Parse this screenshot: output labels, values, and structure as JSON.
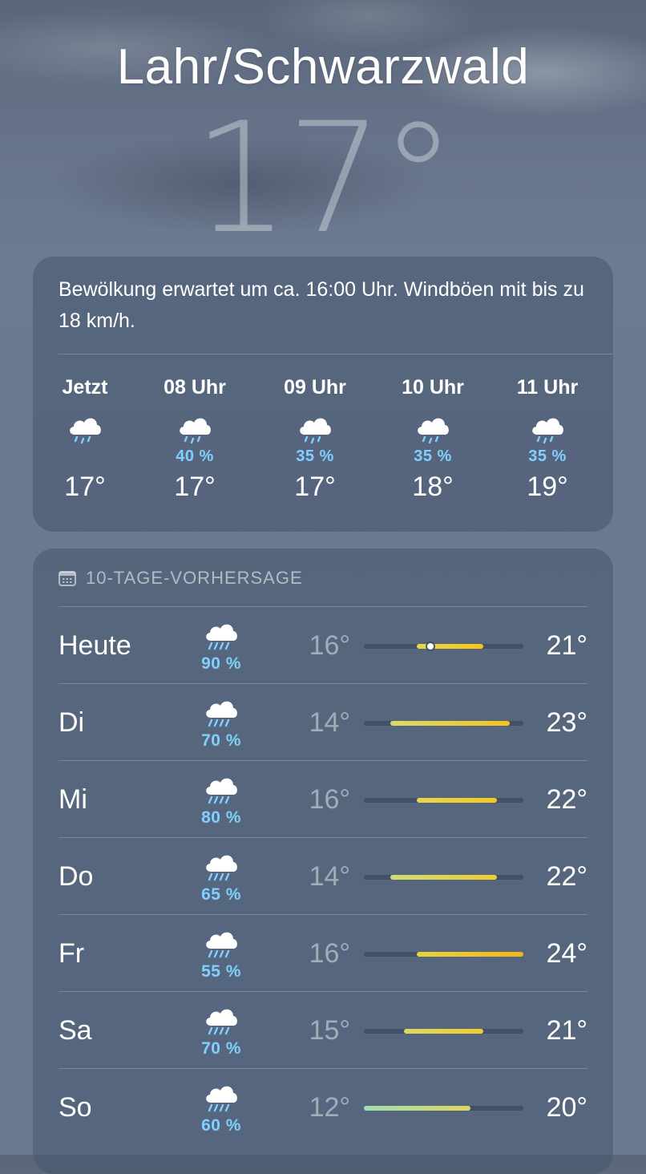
{
  "location": {
    "city": "Lahr/Schwarzwald",
    "current_temp": "17°"
  },
  "hourly": {
    "summary": "Bewölkung erwartet um ca. 16:00 Uhr. Windböen mit bis zu 18 km/h.",
    "items": [
      {
        "label": "Jetzt",
        "icon": "cloud-drizzle-icon",
        "prob": "",
        "temp": "17°"
      },
      {
        "label": "08 Uhr",
        "icon": "cloud-drizzle-icon",
        "prob": "40 %",
        "temp": "17°"
      },
      {
        "label": "09 Uhr",
        "icon": "cloud-drizzle-icon",
        "prob": "35 %",
        "temp": "17°"
      },
      {
        "label": "10 Uhr",
        "icon": "cloud-drizzle-icon",
        "prob": "35 %",
        "temp": "18°"
      },
      {
        "label": "11 Uhr",
        "icon": "cloud-drizzle-icon",
        "prob": "35 %",
        "temp": "19°"
      }
    ]
  },
  "daily": {
    "header": "10-TAGE-VORHERSAGE",
    "header_icon": "calendar-icon",
    "range": {
      "min": 12,
      "max": 24
    },
    "current_temp_value": 17,
    "items": [
      {
        "day": "Heute",
        "icon": "cloud-rain-icon",
        "prob": "90 %",
        "min": "16°",
        "max": "21°",
        "min_value": 16,
        "max_value": 21,
        "bar_colors": [
          "#e8d84a",
          "#f5c518"
        ],
        "show_current": true
      },
      {
        "day": "Di",
        "icon": "cloud-rain-icon",
        "prob": "70 %",
        "min": "14°",
        "max": "23°",
        "min_value": 14,
        "max_value": 23,
        "bar_colors": [
          "#d8dc6a",
          "#f4c21c"
        ],
        "show_current": false
      },
      {
        "day": "Mi",
        "icon": "cloud-rain-icon",
        "prob": "80 %",
        "min": "16°",
        "max": "22°",
        "min_value": 16,
        "max_value": 22,
        "bar_colors": [
          "#ead64a",
          "#f3c820"
        ],
        "show_current": false
      },
      {
        "day": "Do",
        "icon": "cloud-rain-icon",
        "prob": "65 %",
        "min": "14°",
        "max": "22°",
        "min_value": 14,
        "max_value": 22,
        "bar_colors": [
          "#cfdc78",
          "#f1cc2c"
        ],
        "show_current": false
      },
      {
        "day": "Fr",
        "icon": "cloud-rain-icon",
        "prob": "55 %",
        "min": "16°",
        "max": "24°",
        "min_value": 16,
        "max_value": 24,
        "bar_colors": [
          "#e9d43a",
          "#f2b51a"
        ],
        "show_current": false
      },
      {
        "day": "Sa",
        "icon": "cloud-rain-icon",
        "prob": "70 %",
        "min": "15°",
        "max": "21°",
        "min_value": 15,
        "max_value": 21,
        "bar_colors": [
          "#dcd862",
          "#f3cc2a"
        ],
        "show_current": false
      },
      {
        "day": "So",
        "icon": "cloud-rain-icon",
        "prob": "60 %",
        "min": "12°",
        "max": "20°",
        "min_value": 12,
        "max_value": 20,
        "bar_colors": [
          "#9fe0b0",
          "#e0d660"
        ],
        "show_current": false
      }
    ]
  }
}
